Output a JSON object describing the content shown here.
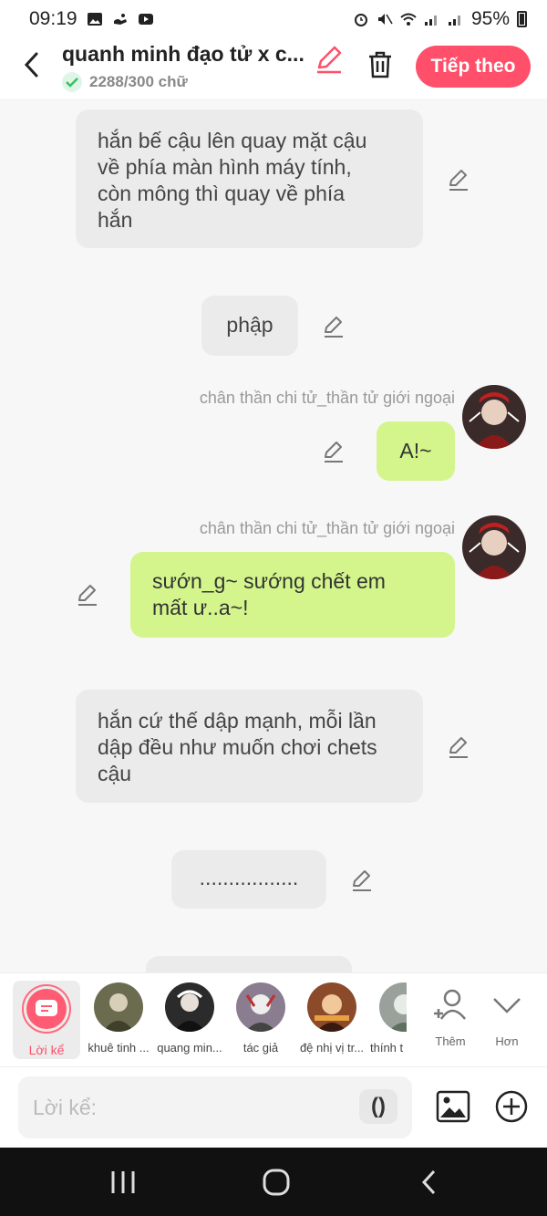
{
  "status": {
    "time": "09:19",
    "battery": "95%"
  },
  "header": {
    "title": "quanh minh đạo tử x c...",
    "word_count": "2288/300 chữ",
    "next_label": "Tiếp theo"
  },
  "chat": {
    "msg1": {
      "lines": [
        "hắn bế cậu lên quay mặt cậu",
        "về phía màn hình máy tính,",
        "còn mông thì quay về phía",
        "hắn"
      ]
    },
    "msg2": {
      "text": "phập"
    },
    "msg3": {
      "speaker": "chân thần chi tử_thần tử giới ngoại",
      "text": "A!~"
    },
    "msg4": {
      "speaker": "chân thần chi tử_thần tử giới ngoại",
      "lines": [
        "sướn_g~ sướng chết em",
        "mất ư..a~!"
      ]
    },
    "msg5": {
      "lines": [
        "hắn cứ thế dập mạnh, mỗi lần",
        "dập đều như muốn chơi chets",
        "cậu"
      ]
    },
    "msg6": {
      "text": "................."
    }
  },
  "characters": {
    "narrator_label": "Lời kể",
    "items": [
      {
        "label": "khuê tinh ...",
        "color": "#6b6b4f"
      },
      {
        "label": "quang min...",
        "color": "#2b2b2b"
      },
      {
        "label": "tác giả",
        "color": "#8a7d8f"
      },
      {
        "label": "đệ nhị vị tr...",
        "color": "#8b4a2a"
      },
      {
        "label": "thính t",
        "color": "#9aa09a"
      }
    ],
    "more_label": "Thêm",
    "less_label": "Hơn"
  },
  "input": {
    "placeholder": "Lời kể:",
    "paren": "()"
  },
  "colors": {
    "accent": "#ff4f6a",
    "my_bubble": "#d3f58c",
    "narration_bubble": "#ebebeb"
  }
}
